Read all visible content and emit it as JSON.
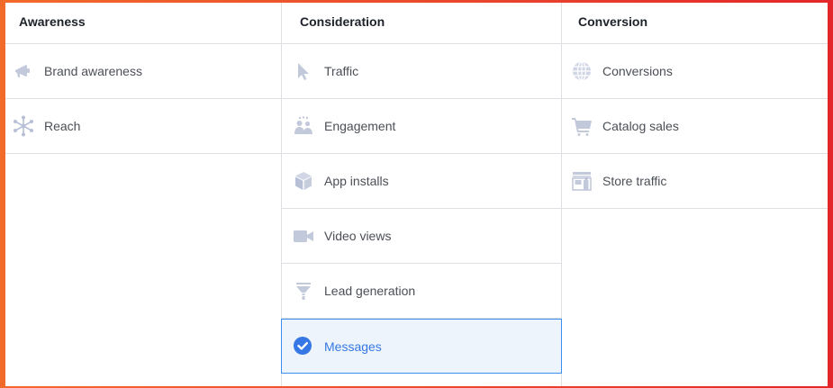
{
  "colors": {
    "icon_gray": "#b7c0d6",
    "selected_blue": "#3578e5",
    "selected_bg": "#edf4fc",
    "border": "#dddfe2",
    "frame_gradient": [
      "#f26a2a",
      "#e3262a"
    ]
  },
  "columns": [
    {
      "header": "Awareness",
      "items": [
        {
          "label": "Brand awareness",
          "icon": "megaphone-icon"
        },
        {
          "label": "Reach",
          "icon": "reach-icon"
        }
      ]
    },
    {
      "header": "Consideration",
      "items": [
        {
          "label": "Traffic",
          "icon": "cursor-icon"
        },
        {
          "label": "Engagement",
          "icon": "people-icon"
        },
        {
          "label": "App installs",
          "icon": "box-icon"
        },
        {
          "label": "Video views",
          "icon": "video-camera-icon"
        },
        {
          "label": "Lead generation",
          "icon": "funnel-icon"
        },
        {
          "label": "Messages",
          "icon": "checkmark-circle-icon",
          "selected": true
        }
      ]
    },
    {
      "header": "Conversion",
      "items": [
        {
          "label": "Conversions",
          "icon": "globe-icon"
        },
        {
          "label": "Catalog sales",
          "icon": "shopping-cart-icon"
        },
        {
          "label": "Store traffic",
          "icon": "store-icon"
        }
      ]
    }
  ]
}
